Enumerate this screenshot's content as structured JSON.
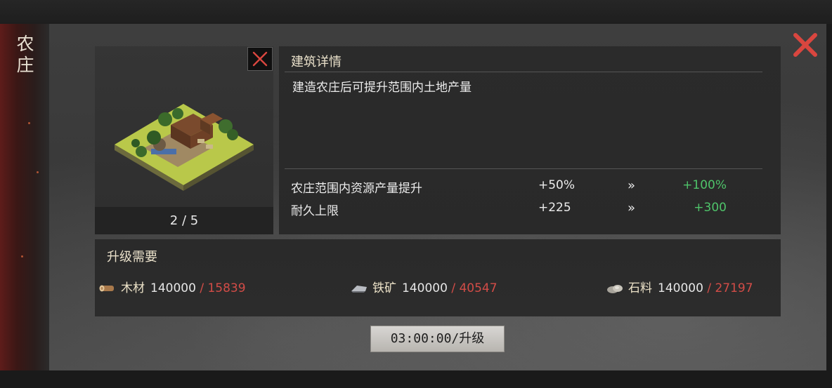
{
  "tab": {
    "title": "农庄"
  },
  "building": {
    "level": "2 / 5",
    "detail_title": "建筑详情",
    "description": "建造农庄后可提升范围内土地产量",
    "stats": [
      {
        "name": "农庄范围内资源产量提升",
        "current": "+50%",
        "arrow": "»",
        "next": "+100%"
      },
      {
        "name": "耐久上限",
        "current": "+225",
        "arrow": "»",
        "next": "+300"
      }
    ]
  },
  "requirements": {
    "title": "升级需要",
    "items": [
      {
        "icon": "wood-icon",
        "name": "木材",
        "need": "140000",
        "slash": "/",
        "have": "15839"
      },
      {
        "icon": "iron-ore-icon",
        "name": "铁矿",
        "need": "140000",
        "slash": "/",
        "have": "40547"
      },
      {
        "icon": "stone-icon",
        "name": "石料",
        "need": "140000",
        "slash": "/",
        "have": "27197"
      }
    ]
  },
  "upgrade_button": {
    "label": "03:00:00/升级"
  },
  "colors": {
    "accent_red": "#d24c47",
    "bonus_green": "#4fc46a",
    "close_red": "#d9463f"
  }
}
